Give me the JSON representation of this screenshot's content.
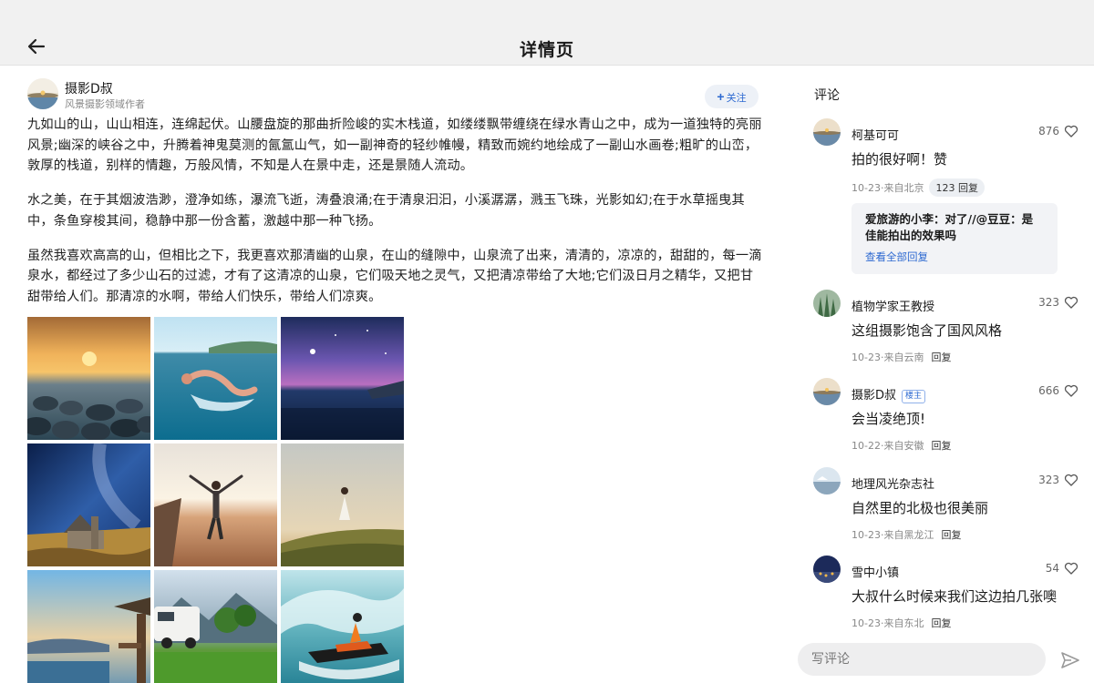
{
  "header": {
    "title": "详情页",
    "back_icon": "back-arrow-icon"
  },
  "author": {
    "name": "摄影D叔",
    "description": "风景摄影领域作者",
    "follow_label": "关注",
    "follow_icon": "plus-icon"
  },
  "article": {
    "paragraphs": [
      "九如山的山，山山相连，连绵起伏。山腰盘旋的那曲折险峻的实木栈道，如缕缕飘带缠绕在绿水青山之中，成为一道独特的亮丽风景;幽深的峡谷之中，升腾着神鬼莫测的氤氲山气，如一副神奇的轻纱帷幔，精致而婉约地绘成了一副山水画卷;粗旷的山峦，敦厚的栈道，别样的情趣，万般风情，不知是人在景中走，还是景随人流动。",
      "水之美，在于其烟波浩渺，澄净如练，瀑流飞逝，涛叠浪涌;在于清泉汩汩，小溪潺潺，溅玉飞珠，光影如幻;在于水草摇曳其中，条鱼穿梭其间，稳静中那一份含蓄，激越中那一种飞扬。",
      "虽然我喜欢高高的山，但相比之下，我更喜欢那清幽的山泉，在山的缝隙中，山泉流了出来，清清的，凉凉的，甜甜的，每一滴泉水，都经过了多少山石的过滤，才有了这清凉的山泉，它们吸天地之灵气，又把清凉带给了大地;它们汲日月之精华，又把甘甜带给人们。那清凉的水啊，带给人们快乐，带给人们凉爽。"
    ]
  },
  "gallery": [
    {
      "name": "sunset-pebbles-photo"
    },
    {
      "name": "swimmer-photo"
    },
    {
      "name": "night-sea-photo"
    },
    {
      "name": "milky-way-church-photo"
    },
    {
      "name": "beach-person-photo"
    },
    {
      "name": "girl-on-hill-photo"
    },
    {
      "name": "lakeside-pavilion-photo"
    },
    {
      "name": "camper-van-photo"
    },
    {
      "name": "jet-ski-photo"
    }
  ],
  "comments_panel": {
    "title": "评论",
    "input_placeholder": "写评论",
    "send_icon": "send-icon",
    "like_icon": "heart-icon",
    "items": [
      {
        "user": "柯基可可",
        "likes": "876",
        "text": "拍的很好啊！赞",
        "meta": "10-23·来自北京",
        "reply_label": "123 回复",
        "sub_reply": {
          "text": "爱旅游的小李：对了//@豆豆：是佳能拍出的效果吗",
          "more_label": "查看全部回复"
        }
      },
      {
        "user": "植物学家王教授",
        "likes": "323",
        "text": "这组摄影饱含了国风风格",
        "meta": "10-23·来自云南",
        "reply_label": "回复"
      },
      {
        "user": "摄影D叔",
        "badge": "楼主",
        "likes": "666",
        "text": "会当凌绝顶!",
        "meta": "10-22·来自安徽",
        "reply_label": "回复"
      },
      {
        "user": "地理风光杂志社",
        "likes": "323",
        "text": "自然里的北极也很美丽",
        "meta": "10-23·来自黑龙江",
        "reply_label": "回复"
      },
      {
        "user": "雪中小镇",
        "likes": "54",
        "text": "大叔什么时候来我们这边拍几张噢",
        "meta": "10-23·来自东北",
        "reply_label": "回复"
      }
    ]
  }
}
